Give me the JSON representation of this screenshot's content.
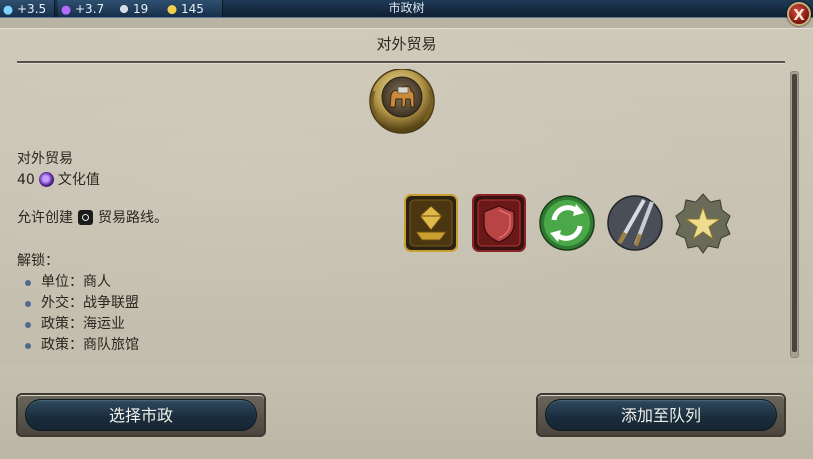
{
  "topbar": {
    "resources": [
      {
        "name": "science",
        "value": "+3.5",
        "color": "#7fd3ff",
        "icon": "flask-icon"
      },
      {
        "name": "culture",
        "value": "+3.7",
        "color": "#b46cff",
        "icon": "culture-icon"
      },
      {
        "name": "faith",
        "value": "19",
        "color": "#d8dce6",
        "icon": "faith-icon"
      },
      {
        "name": "gold",
        "value": "145",
        "color": "#f3cf4d",
        "icon": "gold-icon"
      }
    ],
    "title": "市政树",
    "close_label": "X"
  },
  "panel": {
    "title": "对外贸易",
    "emblem_icon": "camel-trade-icon",
    "civic_name": "对外贸易",
    "cost_value": "40",
    "cost_unit": "文化值",
    "description_prefix": "允许创建",
    "description_suffix": "贸易路线。",
    "unlocks_heading": "解锁：",
    "unlocks": [
      "单位：商人",
      "外交：战争联盟",
      "政策：海运业",
      "政策：商队旅馆"
    ],
    "unlock_icons": [
      {
        "name": "economic-policy-card-icon",
        "color": "#c9a030"
      },
      {
        "name": "military-policy-card-icon",
        "color": "#b03a3a"
      },
      {
        "name": "recycle-arrows-icon",
        "color": "#4aa848"
      },
      {
        "name": "crossed-swords-icon",
        "color": "#8a8f9a"
      },
      {
        "name": "star-badge-icon",
        "color": "#e6cf7a"
      }
    ]
  },
  "buttons": {
    "select_civic": "选择市政",
    "add_to_queue": "添加至队列"
  }
}
